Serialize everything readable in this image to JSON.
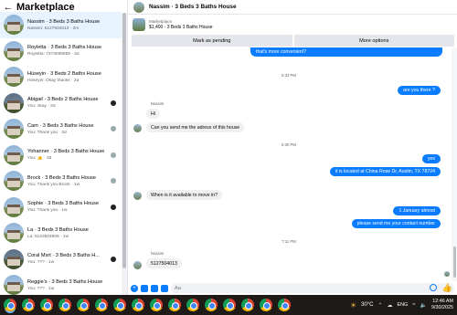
{
  "sidebar": {
    "title": "Marketplace",
    "back_icon": "arrow-left-icon",
    "conversations": [
      {
        "name": "Nassim · 3 Beds 3 Baths House",
        "preview": "Nassim: 5127504013 · 2m"
      },
      {
        "name": "Roylettа · 3 Beds 3 Baths House",
        "preview": "Roylettа: 7373096959 · 2d"
      },
      {
        "name": "Hüseyin · 3 Beds 2 Baths House",
        "preview": "Hüseyin: Okay thanks · 2d"
      },
      {
        "name": "Abigail · 3 Beds 2 Baths House",
        "preview": "You: okay · 2d"
      },
      {
        "name": "Cam · 3 Beds 3 Baths House",
        "preview": "You: Thank you · 2d"
      },
      {
        "name": "Yohanner · 3 Beds 3 Baths House",
        "preview": "You: 👍 · 3d"
      },
      {
        "name": "Brock · 3 Beds 3 Baths House",
        "preview": "You: Thank you Brock · 1w"
      },
      {
        "name": "Sophie · 3 Beds 3 Baths House",
        "preview": "You: Thank you · 1w"
      },
      {
        "name": "La · 3 Beds 3 Baths House",
        "preview": "La: 5123504806 · 1w"
      },
      {
        "name": "Coral Msrt · 3 Beds 3 Baths H...",
        "preview": "You: ??? · 1w"
      },
      {
        "name": "Reggie's · 3 Beds 3 Baths House",
        "preview": "You: ??? · 1w"
      }
    ]
  },
  "chat": {
    "title": "Nassim · 3 Beds 3 Baths House",
    "listing_label": "Marketplace",
    "listing_price": "$1,400 · 3 Beds 3 Baths House",
    "mark_pending_label": "Mark as pending",
    "more_options_label": "More options",
    "partial_out_line1": "that's more convenient?",
    "times": [
      "5:33 PM",
      "5:30 PM",
      "7:11 PM"
    ],
    "sender_name": "Nassim",
    "msgs": {
      "are_you_there": "are you there ?",
      "hi": "Hi",
      "adress": "Can you send me the  adress of this house",
      "yes": "yes",
      "located": "it is located at  China Rose Dr, Austin, TX 78724",
      "available": "When is it available to move in?",
      "january": "1 January almost",
      "contact": "please send me your contact number",
      "number": "5127504013"
    },
    "input_placeholder": "Aa"
  },
  "taskbar": {
    "temperature": "30°C",
    "language": "ENG",
    "time": "12:46 AM",
    "date": "9/30/2025",
    "app_icon": "chrome-icon",
    "app_count": 16
  },
  "colors": {
    "accent": "#0a7cff",
    "outgoing_bubble": "#0a7cff",
    "incoming_bubble": "#f0f0f0",
    "taskbar": "#1e1a17"
  }
}
